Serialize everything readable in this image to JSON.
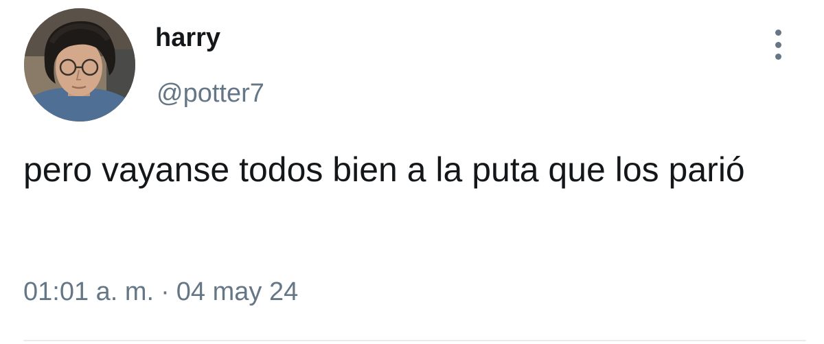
{
  "tweet": {
    "author": {
      "display_name": "harry",
      "handle": "@potter7"
    },
    "text": "pero vayanse todos bien a la puta que los parió",
    "timestamp": {
      "time": "01:01 a. m.",
      "separator": "·",
      "date": "04 may 24"
    },
    "icons": {
      "more": "more-vertical-icon",
      "avatar": "user-avatar"
    }
  },
  "colors": {
    "text_primary": "#14171a",
    "text_secondary": "#657786",
    "divider": "#e6ecf0",
    "background": "#ffffff"
  }
}
